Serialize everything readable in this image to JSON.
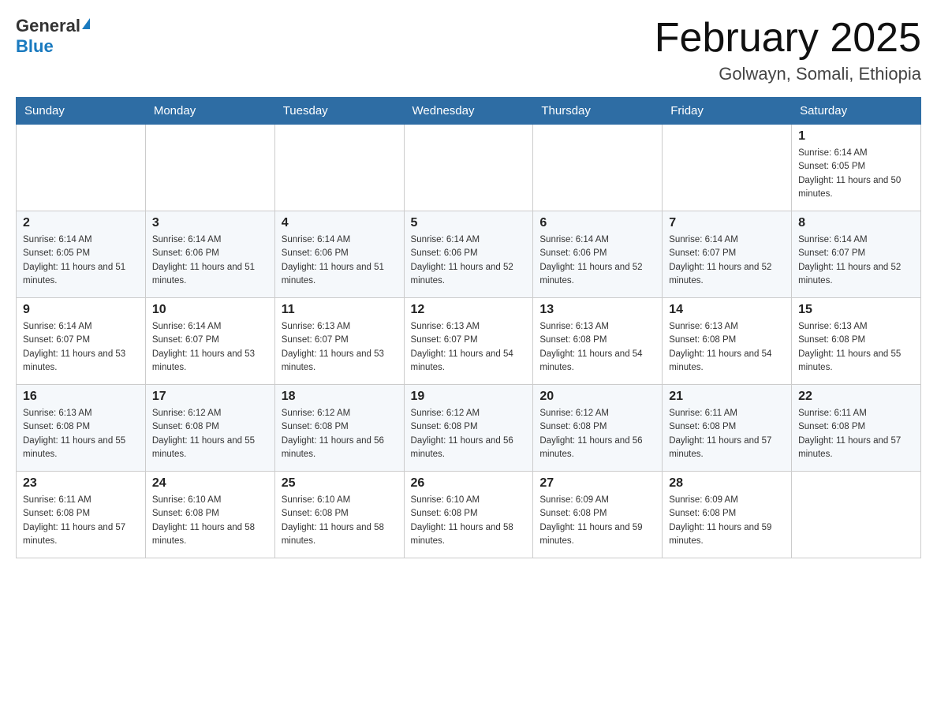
{
  "header": {
    "logo_general": "General",
    "logo_blue": "Blue",
    "month_title": "February 2025",
    "location": "Golwayn, Somali, Ethiopia"
  },
  "weekdays": [
    "Sunday",
    "Monday",
    "Tuesday",
    "Wednesday",
    "Thursday",
    "Friday",
    "Saturday"
  ],
  "weeks": [
    [
      {
        "day": "",
        "sunrise": "",
        "sunset": "",
        "daylight": ""
      },
      {
        "day": "",
        "sunrise": "",
        "sunset": "",
        "daylight": ""
      },
      {
        "day": "",
        "sunrise": "",
        "sunset": "",
        "daylight": ""
      },
      {
        "day": "",
        "sunrise": "",
        "sunset": "",
        "daylight": ""
      },
      {
        "day": "",
        "sunrise": "",
        "sunset": "",
        "daylight": ""
      },
      {
        "day": "",
        "sunrise": "",
        "sunset": "",
        "daylight": ""
      },
      {
        "day": "1",
        "sunrise": "Sunrise: 6:14 AM",
        "sunset": "Sunset: 6:05 PM",
        "daylight": "Daylight: 11 hours and 50 minutes."
      }
    ],
    [
      {
        "day": "2",
        "sunrise": "Sunrise: 6:14 AM",
        "sunset": "Sunset: 6:05 PM",
        "daylight": "Daylight: 11 hours and 51 minutes."
      },
      {
        "day": "3",
        "sunrise": "Sunrise: 6:14 AM",
        "sunset": "Sunset: 6:06 PM",
        "daylight": "Daylight: 11 hours and 51 minutes."
      },
      {
        "day": "4",
        "sunrise": "Sunrise: 6:14 AM",
        "sunset": "Sunset: 6:06 PM",
        "daylight": "Daylight: 11 hours and 51 minutes."
      },
      {
        "day": "5",
        "sunrise": "Sunrise: 6:14 AM",
        "sunset": "Sunset: 6:06 PM",
        "daylight": "Daylight: 11 hours and 52 minutes."
      },
      {
        "day": "6",
        "sunrise": "Sunrise: 6:14 AM",
        "sunset": "Sunset: 6:06 PM",
        "daylight": "Daylight: 11 hours and 52 minutes."
      },
      {
        "day": "7",
        "sunrise": "Sunrise: 6:14 AM",
        "sunset": "Sunset: 6:07 PM",
        "daylight": "Daylight: 11 hours and 52 minutes."
      },
      {
        "day": "8",
        "sunrise": "Sunrise: 6:14 AM",
        "sunset": "Sunset: 6:07 PM",
        "daylight": "Daylight: 11 hours and 52 minutes."
      }
    ],
    [
      {
        "day": "9",
        "sunrise": "Sunrise: 6:14 AM",
        "sunset": "Sunset: 6:07 PM",
        "daylight": "Daylight: 11 hours and 53 minutes."
      },
      {
        "day": "10",
        "sunrise": "Sunrise: 6:14 AM",
        "sunset": "Sunset: 6:07 PM",
        "daylight": "Daylight: 11 hours and 53 minutes."
      },
      {
        "day": "11",
        "sunrise": "Sunrise: 6:13 AM",
        "sunset": "Sunset: 6:07 PM",
        "daylight": "Daylight: 11 hours and 53 minutes."
      },
      {
        "day": "12",
        "sunrise": "Sunrise: 6:13 AM",
        "sunset": "Sunset: 6:07 PM",
        "daylight": "Daylight: 11 hours and 54 minutes."
      },
      {
        "day": "13",
        "sunrise": "Sunrise: 6:13 AM",
        "sunset": "Sunset: 6:08 PM",
        "daylight": "Daylight: 11 hours and 54 minutes."
      },
      {
        "day": "14",
        "sunrise": "Sunrise: 6:13 AM",
        "sunset": "Sunset: 6:08 PM",
        "daylight": "Daylight: 11 hours and 54 minutes."
      },
      {
        "day": "15",
        "sunrise": "Sunrise: 6:13 AM",
        "sunset": "Sunset: 6:08 PM",
        "daylight": "Daylight: 11 hours and 55 minutes."
      }
    ],
    [
      {
        "day": "16",
        "sunrise": "Sunrise: 6:13 AM",
        "sunset": "Sunset: 6:08 PM",
        "daylight": "Daylight: 11 hours and 55 minutes."
      },
      {
        "day": "17",
        "sunrise": "Sunrise: 6:12 AM",
        "sunset": "Sunset: 6:08 PM",
        "daylight": "Daylight: 11 hours and 55 minutes."
      },
      {
        "day": "18",
        "sunrise": "Sunrise: 6:12 AM",
        "sunset": "Sunset: 6:08 PM",
        "daylight": "Daylight: 11 hours and 56 minutes."
      },
      {
        "day": "19",
        "sunrise": "Sunrise: 6:12 AM",
        "sunset": "Sunset: 6:08 PM",
        "daylight": "Daylight: 11 hours and 56 minutes."
      },
      {
        "day": "20",
        "sunrise": "Sunrise: 6:12 AM",
        "sunset": "Sunset: 6:08 PM",
        "daylight": "Daylight: 11 hours and 56 minutes."
      },
      {
        "day": "21",
        "sunrise": "Sunrise: 6:11 AM",
        "sunset": "Sunset: 6:08 PM",
        "daylight": "Daylight: 11 hours and 57 minutes."
      },
      {
        "day": "22",
        "sunrise": "Sunrise: 6:11 AM",
        "sunset": "Sunset: 6:08 PM",
        "daylight": "Daylight: 11 hours and 57 minutes."
      }
    ],
    [
      {
        "day": "23",
        "sunrise": "Sunrise: 6:11 AM",
        "sunset": "Sunset: 6:08 PM",
        "daylight": "Daylight: 11 hours and 57 minutes."
      },
      {
        "day": "24",
        "sunrise": "Sunrise: 6:10 AM",
        "sunset": "Sunset: 6:08 PM",
        "daylight": "Daylight: 11 hours and 58 minutes."
      },
      {
        "day": "25",
        "sunrise": "Sunrise: 6:10 AM",
        "sunset": "Sunset: 6:08 PM",
        "daylight": "Daylight: 11 hours and 58 minutes."
      },
      {
        "day": "26",
        "sunrise": "Sunrise: 6:10 AM",
        "sunset": "Sunset: 6:08 PM",
        "daylight": "Daylight: 11 hours and 58 minutes."
      },
      {
        "day": "27",
        "sunrise": "Sunrise: 6:09 AM",
        "sunset": "Sunset: 6:08 PM",
        "daylight": "Daylight: 11 hours and 59 minutes."
      },
      {
        "day": "28",
        "sunrise": "Sunrise: 6:09 AM",
        "sunset": "Sunset: 6:08 PM",
        "daylight": "Daylight: 11 hours and 59 minutes."
      },
      {
        "day": "",
        "sunrise": "",
        "sunset": "",
        "daylight": ""
      }
    ]
  ]
}
